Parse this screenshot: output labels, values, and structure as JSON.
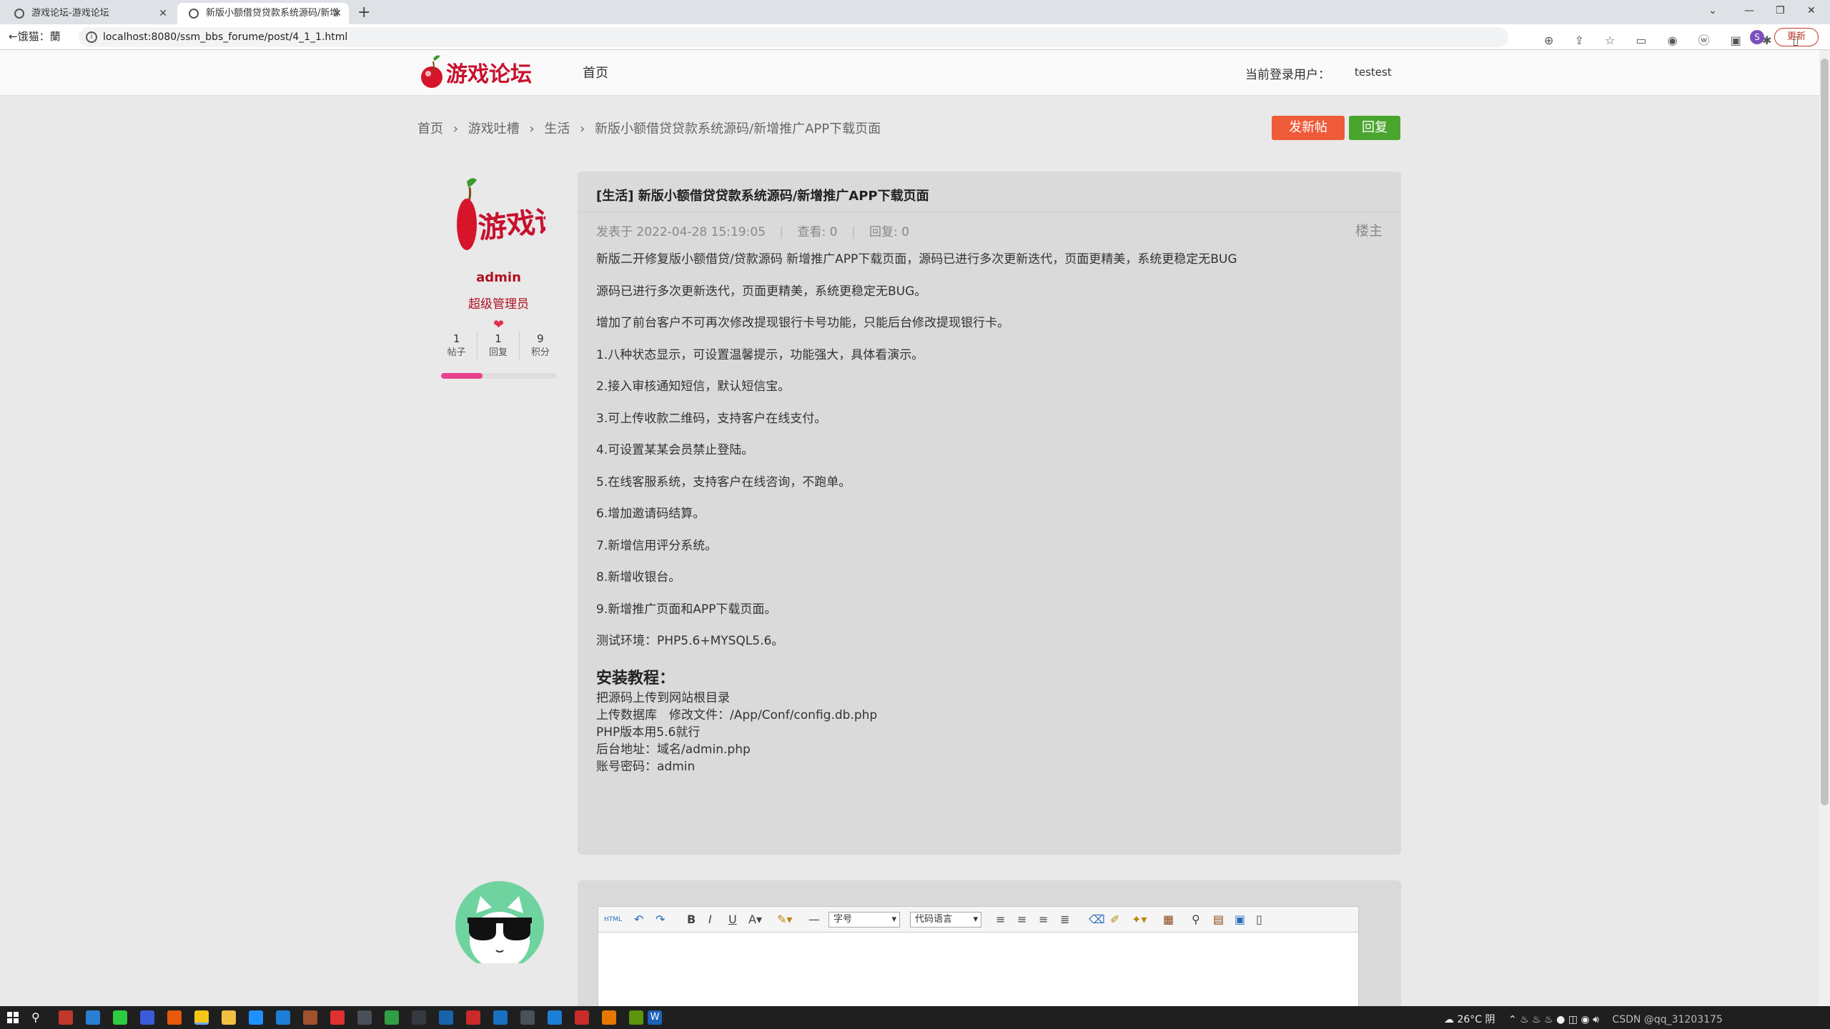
{
  "browser": {
    "tabs": [
      {
        "label": "游戏论坛-游戏论坛"
      },
      {
        "label": "新版小额借贷贷款系统源码/新增"
      }
    ],
    "back_label": "←饿猫：蘭",
    "url": "localhost:8080/ssm_bbs_forume/post/4_1_1.html",
    "profile_initial": "S",
    "update_label": "更新"
  },
  "header": {
    "logo_text": "游戏论坛",
    "nav_home": "首页",
    "user_label": "当前登录用户：",
    "username": "testest"
  },
  "breadcrumb": {
    "items": [
      "首页",
      "游戏吐槽",
      "生活",
      "新版小额借贷贷款系统源码/新增推广APP下载页面"
    ],
    "sep": "›"
  },
  "actions": {
    "new_post": "发新帖",
    "reply": "回复"
  },
  "author": {
    "name": "admin",
    "role": "超级管理员",
    "stats": [
      {
        "value": "1",
        "label": "帖子"
      },
      {
        "value": "1",
        "label": "回复"
      },
      {
        "value": "9",
        "label": "积分"
      }
    ],
    "level_progress": 0.36,
    "colors": {
      "name": "#b01020",
      "bar": "#e8418a"
    }
  },
  "post": {
    "title": "[生活] 新版小额借贷贷款系统源码/新增推广APP下载页面",
    "posted_at": "发表于 2022-04-28 15:19:05",
    "views": "查看: 0",
    "replies": "回复: 0",
    "floor": "楼主",
    "paragraphs": [
      "新版二开修复版小额借贷/贷款源码 新增推广APP下载页面，源码已进行多次更新迭代，页面更精美，系统更稳定无BUG",
      "源码已进行多次更新迭代，页面更精美，系统更稳定无BUG。",
      "增加了前台客户不可再次修改提现银行卡号功能，只能后台修改提现银行卡。",
      "1.八种状态显示，可设置温馨提示，功能强大，具体看演示。",
      "2.接入审核通知短信，默认短信宝。",
      "3.可上传收款二维码，支持客户在线支付。",
      "4.可设置某某会员禁止登陆。",
      "5.在线客服系统，支持客户在线咨询，不跑单。",
      "6.增加邀请码结算。",
      "7.新增信用评分系统。",
      "8.新增收银台。",
      "9.新增推广页面和APP下载页面。",
      "测试环境：PHP5.6+MYSQL5.6。"
    ],
    "install_heading": "安装教程：",
    "install_lines": [
      "把源码上传到网站根目录",
      "上传数据库　修改文件：/App/Conf/config.db.php",
      "PHP版本用5.6就行",
      "后台地址：域名/admin.php",
      "账号密码：admin"
    ]
  },
  "editor": {
    "html_label": "HTML",
    "font_size": "字号",
    "code_lang": "代码语言"
  },
  "taskbar": {
    "weather": "26°C 阴",
    "watermark": "CSDN @qq_31203175"
  }
}
